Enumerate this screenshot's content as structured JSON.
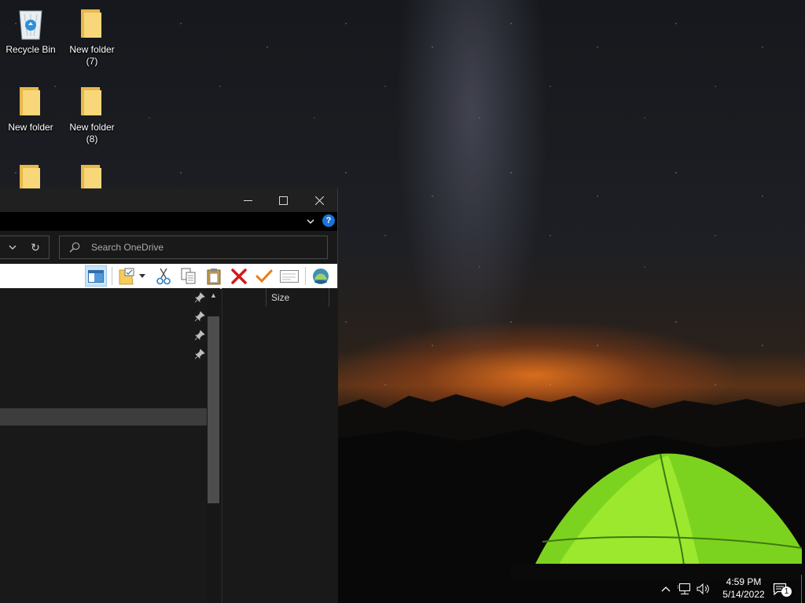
{
  "desktop": {
    "icons": [
      {
        "label": "Recycle Bin",
        "icon": "recycle-bin-icon"
      },
      {
        "label": "New folder\n(7)",
        "icon": "folder-icon"
      },
      {
        "label": "New folder",
        "icon": "folder-icon"
      },
      {
        "label": "New folder\n(8)",
        "icon": "folder-icon"
      },
      {
        "label": "",
        "icon": "folder-icon"
      },
      {
        "label": "",
        "icon": "folder-icon"
      }
    ]
  },
  "explorer": {
    "title": "",
    "caption_buttons": {
      "minimize": "—",
      "maximize": "☐",
      "close": "✕"
    },
    "ribbon_expand_glyph": "⌄",
    "help_glyph": "?",
    "address_dropdown_glyph": "⌄",
    "refresh_glyph": "↻",
    "search": {
      "placeholder": "Search OneDrive",
      "value": ""
    },
    "toolbar_icons": [
      "preview-pane-icon",
      "new-folder-icon",
      "dropdown-arrow-icon",
      "cut-icon",
      "copy-icon",
      "paste-icon",
      "delete-icon",
      "checkmark-icon",
      "email-icon",
      "shell-icon"
    ],
    "columns": [
      {
        "label": "Size"
      }
    ],
    "scroll_up_glyph": "▲"
  },
  "taskbar": {
    "tray_icons": [
      "show-hidden-icons-chevron",
      "network-icon",
      "volume-icon",
      "action-center-icon"
    ],
    "clock": {
      "time": "4:59 PM",
      "date": "5/14/2022"
    },
    "notification_count": "1"
  },
  "colors": {
    "window_bg": "#191919",
    "titlebar_bg": "#202020",
    "toolbar_bg": "#ffffff",
    "help_blue": "#1a73d9",
    "selection_bg": "#3d3d3d",
    "folder_yellow": "#f5cc5e"
  }
}
